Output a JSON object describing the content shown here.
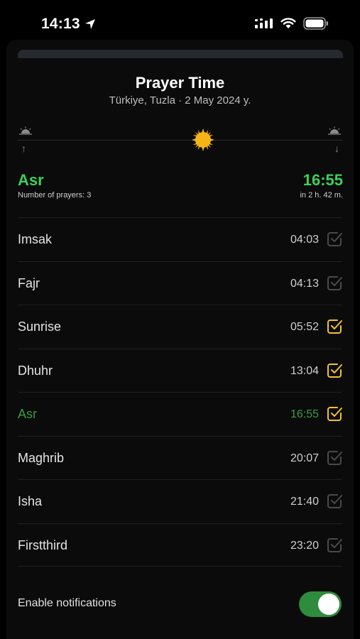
{
  "status_bar": {
    "time": "14:13",
    "icons": [
      "location-arrow-icon",
      "signal-icon",
      "wifi-icon",
      "battery-icon"
    ]
  },
  "header": {
    "title": "Prayer Time",
    "subtitle": "Türkiye, Tuzla · 2 May 2024 y."
  },
  "timeline": {
    "icons": [
      "sunrise-icon",
      "sun-icon",
      "sunset-icon"
    ]
  },
  "current": {
    "name": "Asr",
    "time": "16:55",
    "count_label": "Number of prayers: 3",
    "remaining": "in 2 h. 42 m."
  },
  "prayers": [
    {
      "name": "Imsak",
      "time": "04:03",
      "checked": false,
      "active": false
    },
    {
      "name": "Fajr",
      "time": "04:13",
      "checked": false,
      "active": false
    },
    {
      "name": "Sunrise",
      "time": "05:52",
      "checked": true,
      "active": false
    },
    {
      "name": "Dhuhr",
      "time": "13:04",
      "checked": true,
      "active": false
    },
    {
      "name": "Asr",
      "time": "16:55",
      "checked": true,
      "active": true
    },
    {
      "name": "Maghrib",
      "time": "20:07",
      "checked": false,
      "active": false
    },
    {
      "name": "Isha",
      "time": "21:40",
      "checked": false,
      "active": false
    },
    {
      "name": "Firstthird",
      "time": "23:20",
      "checked": false,
      "active": false
    }
  ],
  "notifications": {
    "label": "Enable notifications",
    "enabled": true
  },
  "colors": {
    "accent_green": "#3ecf5a",
    "active_row_green": "#3a9a45",
    "check_yellow": "#f2c230",
    "check_gray": "#4a4a4a",
    "toggle_green": "#2f8c3e",
    "sun": "#f5b316"
  }
}
